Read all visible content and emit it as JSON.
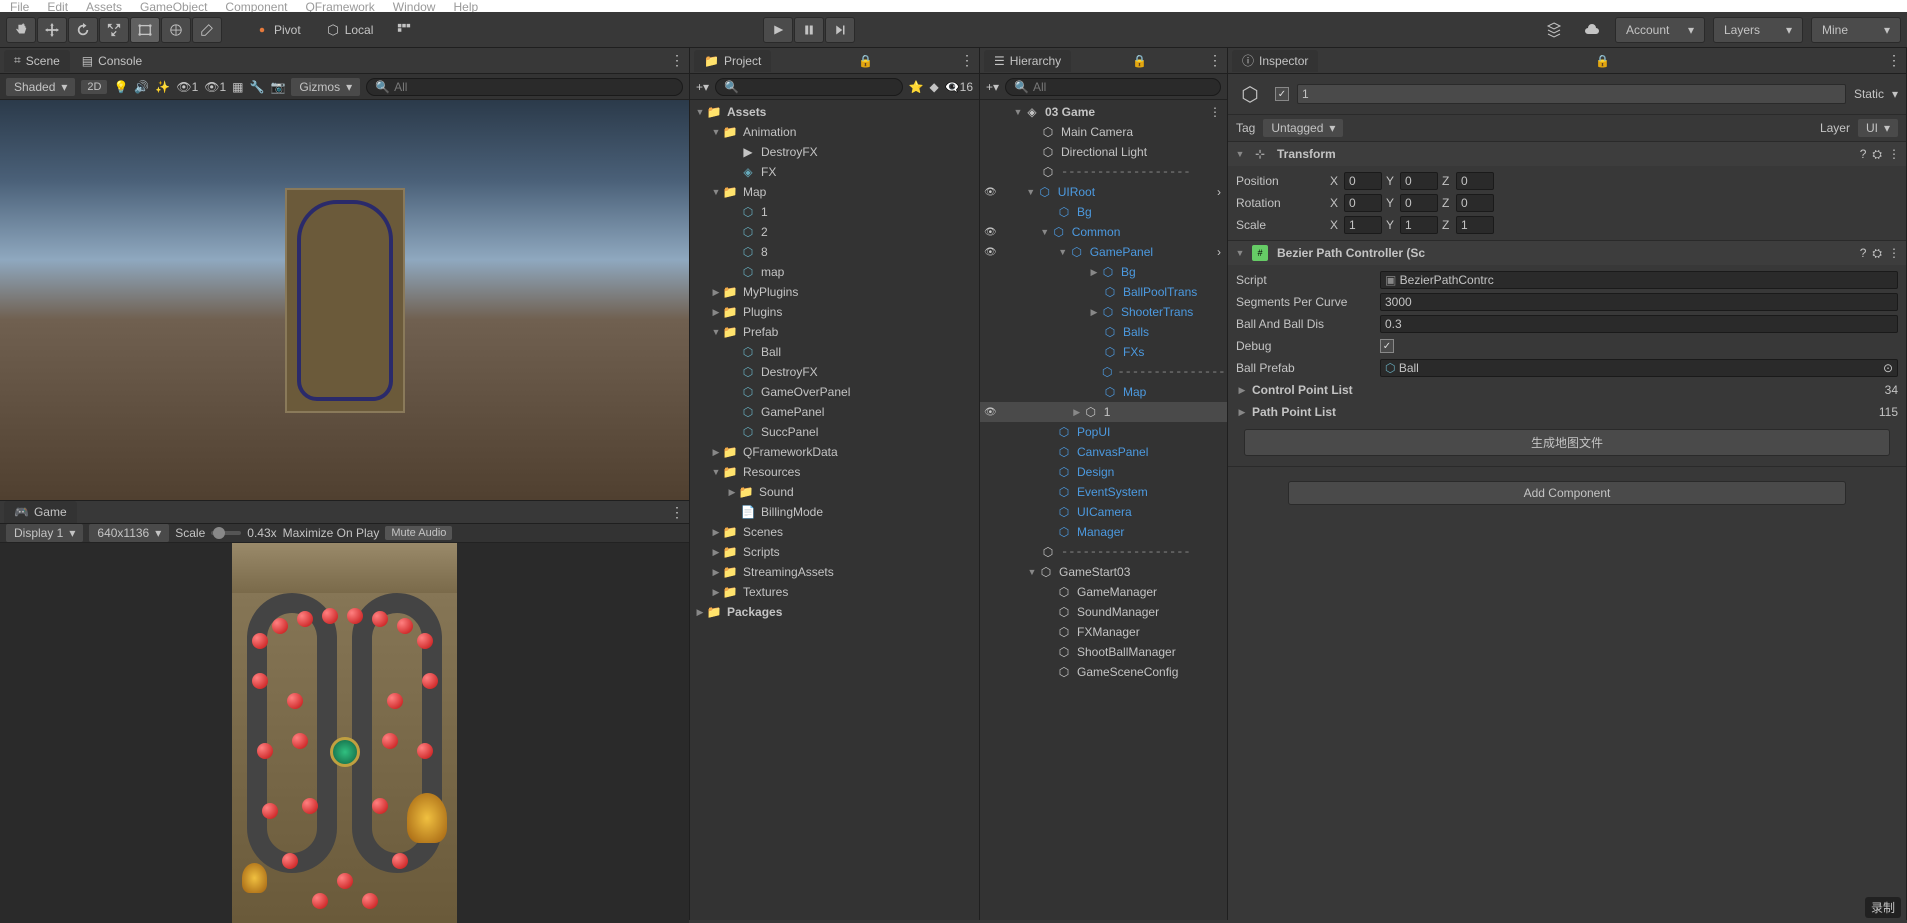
{
  "menubar": [
    "File",
    "Edit",
    "Assets",
    "GameObject",
    "Component",
    "QFramework",
    "Window",
    "Help"
  ],
  "toolbar": {
    "pivot": "Pivot",
    "local": "Local",
    "account": "Account",
    "layers": "Layers",
    "layout": "Mine"
  },
  "scene": {
    "tab_scene": "Scene",
    "tab_console": "Console",
    "shading": "Shaded",
    "twod": "2D",
    "gizmos": "Gizmos",
    "search_ph": "All"
  },
  "game": {
    "tab": "Game",
    "display": "Display 1",
    "resolution": "640x1136",
    "scale_label": "Scale",
    "scale_value": "0.43x",
    "maximize": "Maximize On Play",
    "mute": "Mute Audio"
  },
  "project": {
    "tab": "Project",
    "hidden_count": "16",
    "tree": {
      "assets": "Assets",
      "animation": "Animation",
      "destroyfx": "DestroyFX",
      "fx": "FX",
      "map": "Map",
      "map_1": "1",
      "map_2": "2",
      "map_8": "8",
      "map_map": "map",
      "myplugins": "MyPlugins",
      "plugins": "Plugins",
      "prefab": "Prefab",
      "pf_ball": "Ball",
      "pf_destroyfx": "DestroyFX",
      "pf_gameover": "GameOverPanel",
      "pf_gamepanel": "GamePanel",
      "pf_succ": "SuccPanel",
      "qframework": "QFrameworkData",
      "resources": "Resources",
      "sound": "Sound",
      "billing": "BillingMode",
      "scenes": "Scenes",
      "scripts": "Scripts",
      "streaming": "StreamingAssets",
      "textures": "Textures",
      "packages": "Packages"
    }
  },
  "hierarchy": {
    "tab": "Hierarchy",
    "search_ph": "All",
    "tree": {
      "scene": "03 Game",
      "main_camera": "Main Camera",
      "dir_light": "Directional Light",
      "divider": "------------------",
      "uiroot": "UIRoot",
      "bg": "Bg",
      "common": "Common",
      "gamepanel": "GamePanel",
      "gp_bg": "Bg",
      "ballpool": "BallPoolTrans",
      "shooter": "ShooterTrans",
      "balls": "Balls",
      "fxs": "FXs",
      "map": "Map",
      "one": "1",
      "popui": "PopUI",
      "canvas": "CanvasPanel",
      "design": "Design",
      "eventsys": "EventSystem",
      "uicamera": "UICamera",
      "manager": "Manager",
      "gamestart": "GameStart03",
      "gamemgr": "GameManager",
      "soundmgr": "SoundManager",
      "fxmgr": "FXManager",
      "shootmgr": "ShootBallManager",
      "gamecfg": "GameSceneConfig"
    }
  },
  "inspector": {
    "tab": "Inspector",
    "name": "1",
    "static": "Static",
    "tag_label": "Tag",
    "tag_value": "Untagged",
    "layer_label": "Layer",
    "layer_value": "UI",
    "transform": {
      "title": "Transform",
      "position": "Position",
      "rotation": "Rotation",
      "scale": "Scale",
      "pos": {
        "x": "0",
        "y": "0",
        "z": "0"
      },
      "rot": {
        "x": "0",
        "y": "0",
        "z": "0"
      },
      "scl": {
        "x": "1",
        "y": "1",
        "z": "1"
      }
    },
    "bezier": {
      "title": "Bezier Path Controller (Sc",
      "script_lbl": "Script",
      "script_val": "BezierPathContrc",
      "segments_lbl": "Segments Per Curve",
      "segments_val": "3000",
      "balldis_lbl": "Ball And Ball Dis",
      "balldis_val": "0.3",
      "debug_lbl": "Debug",
      "prefab_lbl": "Ball Prefab",
      "prefab_val": "Ball",
      "ctrl_lbl": "Control Point List",
      "ctrl_val": "34",
      "path_lbl": "Path Point List",
      "path_val": "115",
      "gen_btn": "生成地图文件"
    },
    "add_component": "Add Component"
  },
  "footer_label": "录制",
  "toolbar_badges": {
    "lights1": "1",
    "lights2": "1"
  }
}
